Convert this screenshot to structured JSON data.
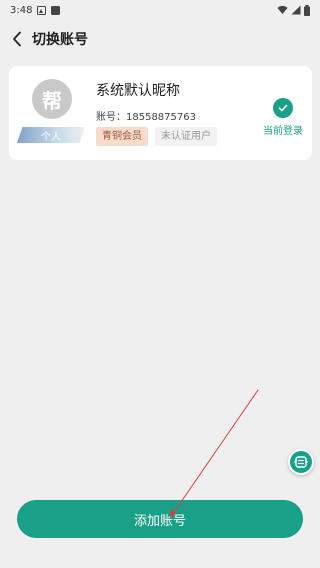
{
  "status_bar": {
    "time": "3:48",
    "icons": [
      "photo-icon",
      "a-icon",
      "wifi-icon",
      "signal-icon",
      "battery-icon"
    ]
  },
  "header": {
    "back_icon": "chevron-left-icon",
    "title": "切换账号"
  },
  "account": {
    "avatar_text": "帮",
    "type_tag": "个人",
    "nickname": "系统默认昵称",
    "account_label": "账号：",
    "account_number": "18558875763",
    "badges": [
      "青铜会员",
      "未认证用户"
    ],
    "current_label": "当前登录"
  },
  "add_button": {
    "label": "添加账号"
  },
  "colors": {
    "accent": "#1a9f88",
    "background": "#efefef",
    "card": "#ffffff",
    "member_badge_bg": "#f6dccd",
    "member_badge_text": "#a4583a",
    "annotation_arrow": "#d9403a"
  }
}
